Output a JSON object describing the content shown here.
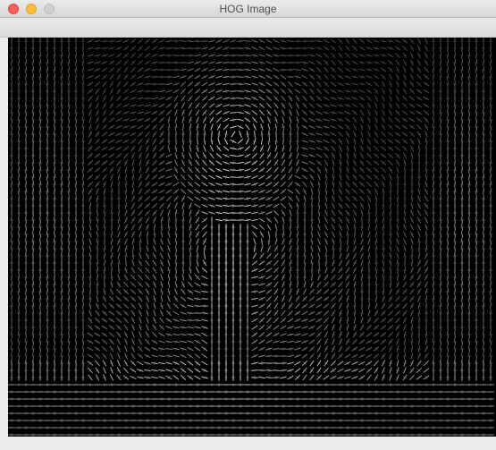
{
  "window": {
    "title": "HOG Image",
    "controls": {
      "close": "close-icon",
      "minimize": "minimize-icon",
      "zoom": "zoom-icon"
    },
    "colors": {
      "close": "#fc605c",
      "minimize": "#fdbc40",
      "zoom_disabled": "#d0d0d0"
    }
  },
  "image": {
    "type": "hog-visualization",
    "background": "#000000",
    "stroke": "#ffffff"
  }
}
